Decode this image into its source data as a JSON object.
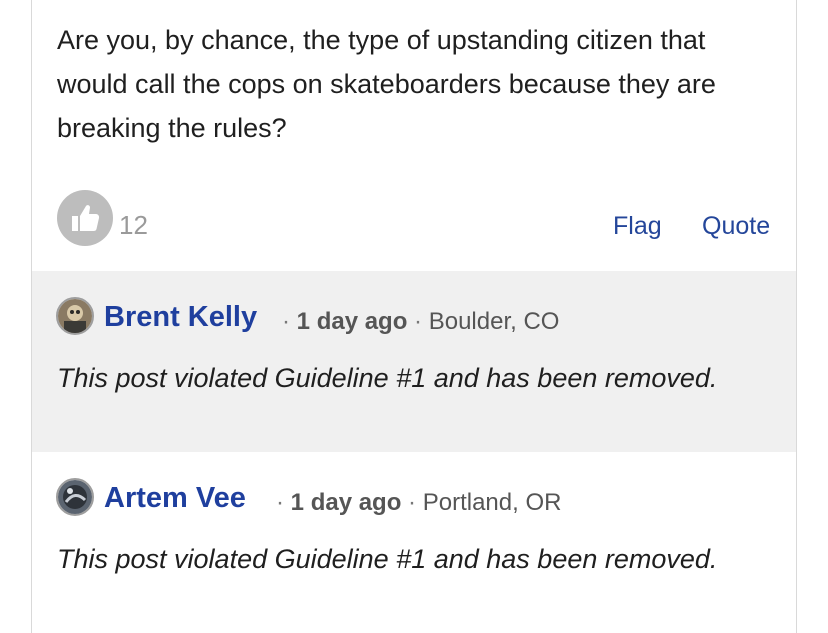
{
  "post": {
    "body": "Are you, by chance, the type of upstanding citizen that would call the cops on skateboarders because they are breaking the rules?",
    "like_count": "12",
    "flag_label": "Flag",
    "quote_label": "Quote"
  },
  "comments": [
    {
      "author": "Brent Kelly",
      "sep1": " · ",
      "time": "1 day ago",
      "sep2": " · ",
      "location": "Boulder, CO",
      "text": "This post violated Guideline #1 and has been removed.",
      "background": "#f0f0f0"
    },
    {
      "author": "Artem Vee",
      "sep1": " · ",
      "time": "1 day ago",
      "sep2": " · ",
      "location": "Portland, OR",
      "text": "This post violated Guideline #1 and has been removed.",
      "background": "#ffffff"
    }
  ],
  "colors": {
    "link": "#24469a",
    "author": "#1f3f9e",
    "like_button": "#bdbdbd",
    "muted": "#9a9a9a"
  },
  "icons": {
    "like": "thumbs-up-icon"
  }
}
